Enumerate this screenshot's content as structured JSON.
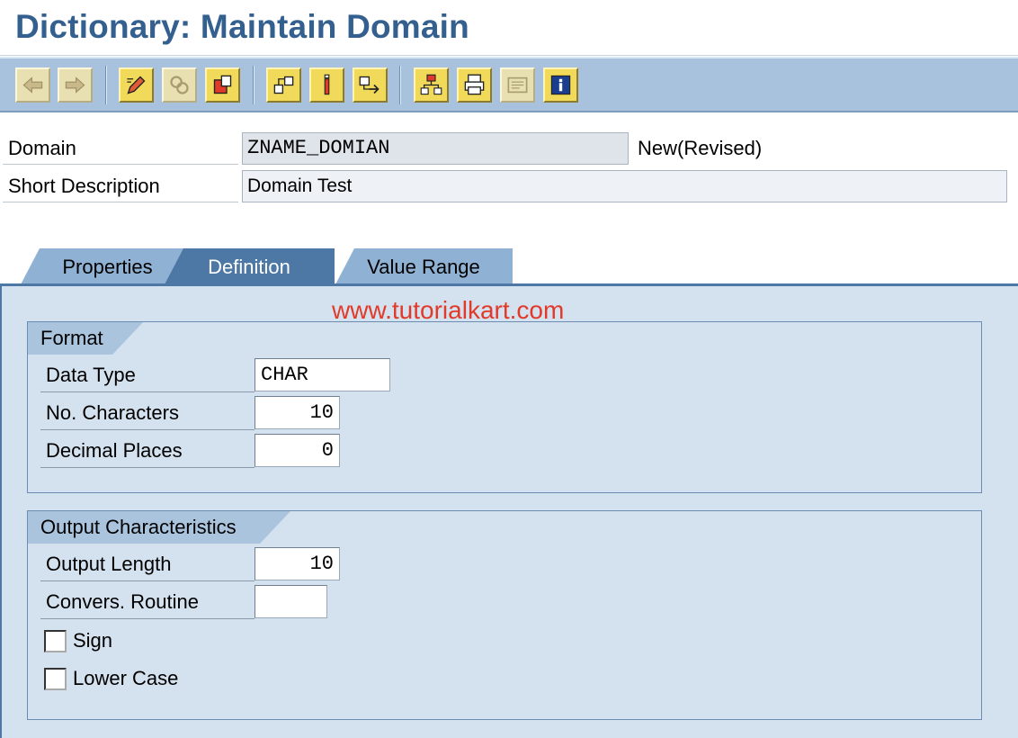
{
  "window": {
    "title": "Dictionary: Maintain Domain"
  },
  "toolbar": {
    "buttons": [
      {
        "name": "back-icon"
      },
      {
        "name": "forward-icon"
      },
      {
        "name": "display-change-icon"
      },
      {
        "name": "other-object-icon"
      },
      {
        "name": "check-icon"
      },
      {
        "name": "activate-icon"
      },
      {
        "name": "where-used-icon"
      },
      {
        "name": "navigate-icon"
      },
      {
        "name": "hierarchy-icon"
      },
      {
        "name": "print-icon"
      },
      {
        "name": "documentation-icon"
      },
      {
        "name": "info-icon"
      }
    ]
  },
  "header": {
    "domain_label": "Domain",
    "domain_value": "ZNAME_DOMIAN",
    "status": "New(Revised)",
    "short_desc_label": "Short Description",
    "short_desc_value": "Domain Test"
  },
  "tabs": [
    {
      "label": "Properties",
      "active": false
    },
    {
      "label": "Definition",
      "active": true
    },
    {
      "label": "Value Range",
      "active": false
    }
  ],
  "watermark": "www.tutorialkart.com",
  "format": {
    "title": "Format",
    "data_type_label": "Data Type",
    "data_type_value": "CHAR",
    "no_chars_label": "No. Characters",
    "no_chars_value": "10",
    "decimal_label": "Decimal Places",
    "decimal_value": "0"
  },
  "output": {
    "title": "Output Characteristics",
    "output_length_label": "Output Length",
    "output_length_value": "10",
    "conv_routine_label": "Convers. Routine",
    "conv_routine_value": "",
    "sign_label": "Sign",
    "sign_checked": false,
    "lower_case_label": "Lower Case",
    "lower_case_checked": false
  },
  "colors": {
    "title_text": "#34608f",
    "toolbar_bg": "#a8c2dd",
    "tab_active": "#4d77a4",
    "tab_inactive": "#8fb1d3",
    "panel_bg": "#d4e1ee",
    "watermark": "#e23a2a"
  }
}
